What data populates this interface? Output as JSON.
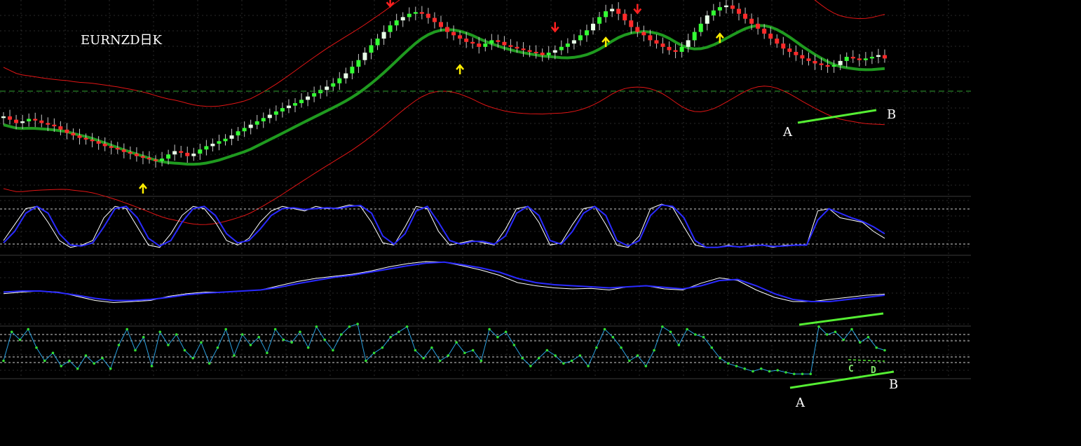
{
  "colors": {
    "background": "#000000",
    "bull_candle": "#33ff33",
    "bull_doji": "#e8ffe8",
    "bear_candle": "#ff2a2a",
    "wick": "#c8c8c8",
    "ma": "#1f9a1f",
    "envelope": "#e01515",
    "up_arrow": "#ffee00",
    "down_arrow": "#ff2020",
    "osc_white": "#ffffff",
    "osc_blue": "#2a2aff",
    "rsi_line": "#2aa0e0",
    "rsi_dots": "#33dd33",
    "annotation_line": "#55ee33"
  },
  "chart_data": [
    {
      "type": "candlestick",
      "title": "EURNZD日K",
      "price_reference": "A",
      "ma_visible": true,
      "envelope_bands": true,
      "grid": true,
      "arrows": {
        "up": [
          0.155,
          0.52,
          0.685,
          0.815
        ],
        "down": [
          0.442,
          0.628,
          0.722
        ]
      },
      "annotations": [
        "A",
        "B"
      ],
      "series": [
        {
          "name": "close",
          "values": [
            0.78,
            0.74,
            0.7,
            0.72,
            0.75,
            0.73,
            0.7,
            0.68,
            0.66,
            0.62,
            0.58,
            0.55,
            0.52,
            0.5,
            0.48,
            0.45,
            0.42,
            0.4,
            0.38,
            0.35,
            0.33,
            0.3,
            0.28,
            0.26,
            0.24,
            0.27,
            0.32,
            0.36,
            0.34,
            0.3,
            0.33,
            0.38,
            0.42,
            0.45,
            0.48,
            0.51,
            0.55,
            0.6,
            0.64,
            0.68,
            0.72,
            0.76,
            0.8,
            0.84,
            0.88,
            0.91,
            0.94,
            0.98,
            1.02,
            1.06,
            1.1,
            1.14,
            1.18,
            1.24,
            1.3,
            1.38,
            1.46,
            1.55,
            1.64,
            1.72,
            1.8,
            1.88,
            1.94,
            1.98,
            2.02,
            2.04,
            2.02,
            1.97,
            1.92,
            1.86,
            1.8,
            1.76,
            1.72,
            1.68,
            1.66,
            1.62,
            1.66,
            1.7,
            1.68,
            1.64,
            1.62,
            1.6,
            1.58,
            1.56,
            1.55,
            1.52,
            1.55,
            1.58,
            1.62,
            1.66,
            1.7,
            1.76,
            1.82,
            1.9,
            1.98,
            2.05,
            2.08,
            2.02,
            1.94,
            1.86,
            1.8,
            1.76,
            1.7,
            1.66,
            1.62,
            1.58,
            1.56,
            1.62,
            1.7,
            1.8,
            1.9,
            2.0,
            2.06,
            2.1,
            2.12,
            2.08,
            2.02,
            1.96,
            1.9,
            1.84,
            1.78,
            1.72,
            1.66,
            1.6,
            1.56,
            1.52,
            1.48,
            1.45,
            1.42,
            1.4,
            1.38,
            1.4,
            1.45,
            1.5,
            1.48,
            1.46,
            1.48,
            1.5,
            1.52,
            1.48
          ]
        }
      ]
    },
    {
      "type": "line",
      "panel": "stochastic",
      "series": [
        {
          "name": "",
          "values": [
            0.2,
            0.55,
            0.9,
            0.95,
            0.6,
            0.2,
            0.05,
            0.1,
            0.2,
            0.7,
            0.95,
            0.9,
            0.5,
            0.1,
            0.05,
            0.35,
            0.75,
            0.95,
            0.9,
            0.6,
            0.2,
            0.1,
            0.25,
            0.6,
            0.85,
            0.95,
            0.9,
            0.85,
            0.95,
            0.9,
            0.92,
            0.98,
            0.95,
            0.6,
            0.15,
            0.1,
            0.5,
            0.95,
            0.9,
            0.4,
            0.1,
            0.15,
            0.2,
            0.15,
            0.1,
            0.45,
            0.9,
            0.95,
            0.6,
            0.1,
            0.15,
            0.55,
            0.9,
            0.95,
            0.55,
            0.1,
            0.05,
            0.3,
            0.9,
            1.0,
            0.92,
            0.5,
            0.1,
            0.05,
            0.05,
            0.1,
            0.05,
            0.1,
            0.1,
            0.05,
            0.1,
            0.1,
            0.1,
            0.85,
            0.9,
            0.7,
            0.65,
            0.6,
            0.4,
            0.25
          ]
        },
        {
          "name": "",
          "values": [
            0.15,
            0.4,
            0.8,
            0.95,
            0.8,
            0.35,
            0.1,
            0.08,
            0.15,
            0.5,
            0.9,
            0.95,
            0.7,
            0.25,
            0.08,
            0.2,
            0.6,
            0.9,
            0.95,
            0.75,
            0.35,
            0.15,
            0.2,
            0.45,
            0.75,
            0.9,
            0.92,
            0.88,
            0.9,
            0.92,
            0.9,
            0.95,
            0.97,
            0.8,
            0.3,
            0.12,
            0.35,
            0.85,
            0.95,
            0.6,
            0.2,
            0.12,
            0.18,
            0.18,
            0.12,
            0.3,
            0.8,
            0.95,
            0.75,
            0.2,
            0.12,
            0.4,
            0.8,
            0.95,
            0.75,
            0.2,
            0.08,
            0.2,
            0.75,
            0.98,
            0.95,
            0.7,
            0.2,
            0.05,
            0.05,
            0.08,
            0.06,
            0.08,
            0.1,
            0.07,
            0.08,
            0.1,
            0.1,
            0.65,
            0.9,
            0.8,
            0.7,
            0.62,
            0.5,
            0.35
          ]
        }
      ]
    },
    {
      "type": "line",
      "panel": "oscillator",
      "annotations": [
        "A",
        "B"
      ],
      "series": [
        {
          "name": "",
          "values": [
            0.35,
            0.38,
            0.4,
            0.38,
            0.3,
            0.22,
            0.18,
            0.2,
            0.22,
            0.3,
            0.35,
            0.38,
            0.38,
            0.4,
            0.42,
            0.5,
            0.58,
            0.64,
            0.68,
            0.72,
            0.78,
            0.86,
            0.92,
            0.96,
            0.95,
            0.88,
            0.8,
            0.7,
            0.56,
            0.5,
            0.46,
            0.44,
            0.45,
            0.42,
            0.48,
            0.5,
            0.44,
            0.42,
            0.55,
            0.65,
            0.6,
            0.42,
            0.28,
            0.2,
            0.2,
            0.24,
            0.28,
            0.32,
            0.34
          ]
        },
        {
          "name": "",
          "values": [
            0.38,
            0.4,
            0.4,
            0.37,
            0.32,
            0.26,
            0.22,
            0.22,
            0.24,
            0.28,
            0.33,
            0.36,
            0.38,
            0.4,
            0.42,
            0.47,
            0.54,
            0.6,
            0.66,
            0.7,
            0.76,
            0.82,
            0.88,
            0.93,
            0.95,
            0.9,
            0.84,
            0.76,
            0.64,
            0.56,
            0.52,
            0.5,
            0.48,
            0.46,
            0.48,
            0.5,
            0.47,
            0.44,
            0.5,
            0.6,
            0.62,
            0.5,
            0.35,
            0.24,
            0.2,
            0.2,
            0.24,
            0.28,
            0.32
          ]
        }
      ]
    },
    {
      "type": "line",
      "panel": "rsi",
      "annotations": [
        "A",
        "B",
        "C",
        "D"
      ],
      "series": [
        {
          "name": "",
          "values": [
            0.3,
            0.85,
            0.7,
            0.9,
            0.55,
            0.3,
            0.45,
            0.2,
            0.3,
            0.15,
            0.4,
            0.25,
            0.35,
            0.15,
            0.6,
            0.9,
            0.5,
            0.75,
            0.2,
            0.85,
            0.6,
            0.8,
            0.5,
            0.35,
            0.65,
            0.25,
            0.55,
            0.9,
            0.4,
            0.8,
            0.6,
            0.75,
            0.45,
            0.9,
            0.7,
            0.65,
            0.85,
            0.55,
            0.95,
            0.7,
            0.5,
            0.8,
            0.95,
            1.0,
            0.3,
            0.45,
            0.55,
            0.75,
            0.85,
            0.95,
            0.5,
            0.35,
            0.55,
            0.3,
            0.4,
            0.65,
            0.45,
            0.5,
            0.3,
            0.9,
            0.75,
            0.85,
            0.6,
            0.35,
            0.2,
            0.35,
            0.5,
            0.4,
            0.25,
            0.3,
            0.4,
            0.2,
            0.55,
            0.9,
            0.75,
            0.55,
            0.3,
            0.4,
            0.2,
            0.5,
            0.95,
            0.85,
            0.6,
            0.9,
            0.8,
            0.75,
            0.55,
            0.35,
            0.25,
            0.2,
            0.15,
            0.1,
            0.15,
            0.1,
            0.12,
            0.08,
            0.05,
            0.05,
            0.05,
            0.95,
            0.8,
            0.85,
            0.7,
            0.9,
            0.65,
            0.75,
            0.55,
            0.5
          ]
        }
      ]
    }
  ]
}
